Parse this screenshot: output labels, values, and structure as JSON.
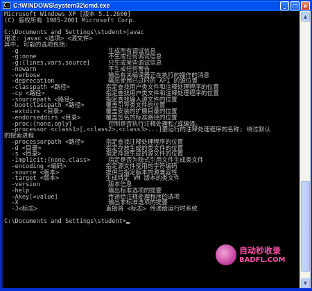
{
  "window": {
    "title": "C:\\WINDOWS\\system32\\cmd.exe",
    "icon_glyph": "C:\\",
    "minimize": "_",
    "maximize": "□",
    "close": "x"
  },
  "console": {
    "lines": [
      "Microsoft Windows XP [版本 5.1.2600]",
      "(C) 版权所有 1985-2001 Microsoft Corp.",
      "",
      "C:\\Documents and Settings\\student>javac",
      "用法: javac <选项> <源文件>",
      "其中, 可能的选项包括:",
      "  -g                         生成所有调试信息",
      "  -g:none                    不生成任何调试信息",
      "  -g:{lines,vars,source}     只生成某些调试信息",
      "  -nowarn                    不生成任何警告",
      "  -verbose                   输出有关编译器正在执行的操作的消息",
      "  -deprecation               输出使用已过时的 API 的源位置",
      "  -classpath <路径>          指定查找用户类文件和注释处理程序的位置",
      "  -cp <路径>                 指定查找用户类文件和注释处理程序的位置",
      "  -sourcepath <路径>         指定查找输入源文件的位置",
      "  -bootclasspath <路径>      覆盖引导类文件的位置",
      "  -extdirs <目录>            覆盖安装的扩展目录的位置",
      "  -endorseddirs <目录>       覆盖签名的标准路径的位置",
      "  -proc:{none,only}          控制是否执行注释处理和/或编译。",
      "  -processor <class1>[,<class2>,<class3>...]要运行的注释处理程序的名称; 绕过默认",
      "的搜索进程",
      "  -processorpath <路径>      指定查找注释处理程序的位置",
      "  -d <目录>                  指定存放生成的类文件的位置",
      "  -s <目录>                  指定存放生成的源文件的位置",
      "  -implicit:{none,class>     指定是否为隐式引用文件生成类文件",
      "  -encoding <编码>           指定源文件使用的字符编码",
      "  -source <版本>             提供与指定版本的源兼容性",
      "  -target <版本>             生成特定 VM 版本的类文件",
      "  -version                   版本信息",
      "  -help                      输出标准选项的提要",
      "  -Akey[=value]              传递给注释处理程序的选项",
      "  -X                         输出非标准选项的提要",
      "  -J<标志>                   直接将 <标志> 传递给运行时系统",
      "",
      "C:\\Documents and Settings\\student>"
    ]
  },
  "watermark": {
    "name": "自动秒收录",
    "url": "BADFL.COM"
  },
  "scrollbar": {
    "up_glyph": "▲",
    "down_glyph": "▼"
  }
}
